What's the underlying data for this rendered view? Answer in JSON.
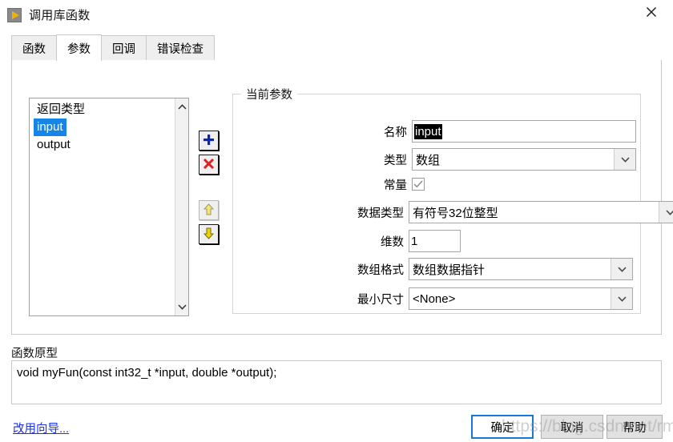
{
  "window": {
    "title": "调用库函数",
    "icon": "labview-run-arrow-icon",
    "close_label": "✕"
  },
  "tabs": [
    {
      "label": "函数",
      "selected": false
    },
    {
      "label": "参数",
      "selected": true
    },
    {
      "label": "回调",
      "selected": false
    },
    {
      "label": "错误检查",
      "selected": false
    }
  ],
  "parameter_list": {
    "items": [
      {
        "label": "返回类型",
        "selected": false
      },
      {
        "label": "input",
        "selected": true
      },
      {
        "label": "output",
        "selected": false
      }
    ],
    "scroll_up": "⌃",
    "scroll_down": "⌄"
  },
  "tool_buttons": {
    "add": "add-parameter",
    "delete": "delete-parameter",
    "move_up": "move-parameter-up",
    "move_down": "move-parameter-down"
  },
  "group": {
    "legend": "当前参数",
    "fields": {
      "name": {
        "label": "名称",
        "value": "input",
        "selected": true
      },
      "type": {
        "label": "类型",
        "value": "数组"
      },
      "constant": {
        "label": "常量",
        "checked": true
      },
      "data_type": {
        "label": "数据类型",
        "value": "有符号32位整型"
      },
      "dimensions": {
        "label": "维数",
        "value": "1"
      },
      "array_format": {
        "label": "数组格式",
        "value": "数组数据指针"
      },
      "min_size": {
        "label": "最小尺寸",
        "value": "<None>"
      }
    },
    "dropdown_arrow": "⌄"
  },
  "prototype": {
    "label": "函数原型",
    "text": "void  myFun(const int32_t *input, double *output);"
  },
  "footer": {
    "wizard_link": "改用向导...",
    "ok": "确定",
    "cancel": "取消",
    "help": "帮助"
  },
  "watermark": {
    "text": "https://blog.csdn.net/rm_iwlaivt"
  },
  "colors": {
    "selection_blue": "#1685e8",
    "link_blue": "#1a31ee",
    "default_button_border": "#1878d4",
    "icon_yellow": "#f2b200",
    "plus_blue": "#0b26b8",
    "delete_red": "#e02020",
    "arrow_yellow": "#f2d200"
  }
}
